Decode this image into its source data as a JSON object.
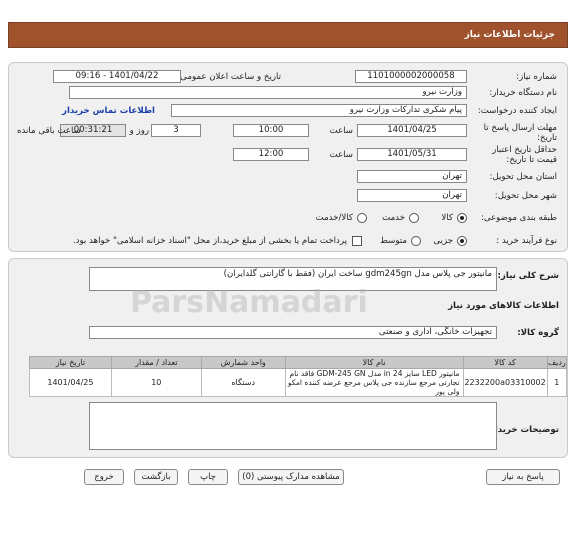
{
  "page": {
    "title": "جزئیات اطلاعات نیاز"
  },
  "fields": {
    "need_number_label": "شماره نیاز:",
    "need_number": "1101000002000058",
    "announce_label": "تاریخ و ساعت اعلان عمومی:",
    "announce_value": "1401/04/22 - 09:16",
    "buyer_label": "نام دستگاه خریدار:",
    "buyer": "وزارت نیرو",
    "creator_label": "ایجاد کننده درخواست:",
    "creator": "پیام شکری تدارکات وزارت نیرو",
    "contact_link": "اطلاعات تماس خریدار",
    "deadline_label": "مهلت ارسال پاسخ تا تاریخ:",
    "deadline_date": "1401/04/25",
    "hour_label": "ساعت",
    "deadline_time": "10:00",
    "days_value": "3",
    "days_label": "روز و",
    "remaining_value": "00:31:21",
    "remaining_label": "ساعت باقی مانده",
    "validity_label": "حداقل تاریخ اعتبار قیمت تا تاریخ:",
    "validity_date": "1401/05/31",
    "validity_time": "12:00",
    "province_label": "استان محل تحویل:",
    "province": "تهران",
    "city_label": "شهر محل تحویل:",
    "city": "تهران",
    "category_label": "طبقه بندی موضوعی:",
    "category_options": [
      "کالا",
      "خدمت",
      "کالا/خدمت"
    ],
    "process_label": "نوع فرآیند خرید :",
    "process_options": [
      "جزیی",
      "متوسط"
    ],
    "payment_note": "پرداخت تمام یا بخشی از مبلغ خرید،از محل \"اسناد خزانه اسلامی\" خواهد بود."
  },
  "need": {
    "summary_label": "شرح کلی نیاز:",
    "summary": "مانیتور جی پلاس مدل gdm245gn ساخت ایران (فقط با گارانتی گلدایران)",
    "goods_title": "اطلاعات کالاهای مورد نیاز",
    "group_label": "گروه کالا:",
    "group": "تجهیزات خانگی، اداری و صنعتی"
  },
  "table": {
    "headers": [
      "ردیف",
      "کد کالا",
      "نام کالا",
      "واحد شمارش",
      "تعداد / مقدار",
      "تاریخ نیاز"
    ],
    "rows": [
      {
        "row": "1",
        "code": "2232200a03310002",
        "name": "مانیتور LED سایز 24 in مدل GDM-245 GN فاقد نام تجارتی مرجع سازنده جی پلاس مرجع عرضه کننده امکو ولی پور",
        "unit": "دستگاه",
        "qty": "10",
        "date": "1401/04/25"
      }
    ]
  },
  "buyer_notes_label": "توضیحات خریدار:",
  "buttons": {
    "reply": "پاسخ به نیاز",
    "docs": "مشاهده مدارک پیوستی (0)",
    "print": "چاپ",
    "back": "بازگشت",
    "exit": "خروج"
  },
  "watermark": "ParsNamadari"
}
